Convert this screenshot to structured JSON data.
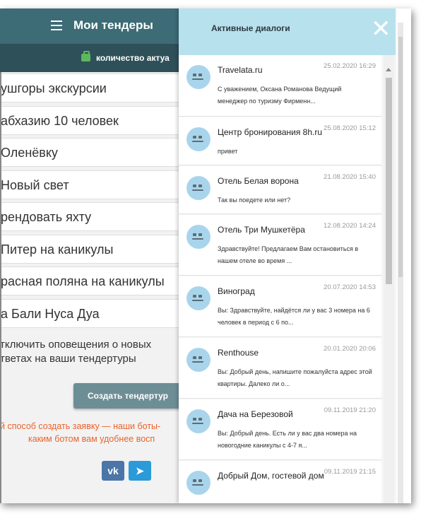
{
  "header": {
    "title": "Мои тендеры"
  },
  "count_bar": {
    "text": "количество актуа"
  },
  "tenders": [
    "ушгоры экскурсии",
    " абхазию 10 человек",
    " Оленёвку",
    " Новый свет",
    "рендовать яхту",
    " Питер на каникулы",
    "расная поляна на каникулы",
    "а Бали Нуса Дуа"
  ],
  "notice": {
    "line1": "тключить оповещения о новых",
    "line2": "тветах на ваши тендертуры"
  },
  "create_button": "Создать тендертур",
  "bots": {
    "line1": "й способ создать заявку — наши боты-",
    "line2": "каким ботом вам удобнее восп"
  },
  "social": {
    "vk": "vk",
    "telegram": "➤"
  },
  "panel": {
    "title": "Активные диалоги",
    "close": "✕"
  },
  "dialogs": [
    {
      "name": "Travelata.ru",
      "date": "25.02.2020 16:29",
      "message": "С уважением, Оксана Романова Ведущий менеджер по туризму Фирменн..."
    },
    {
      "name": "Центр бронирования 8h.ru",
      "date": "25.08.2020 15:12",
      "message": "привет"
    },
    {
      "name": "Отель Белая ворона",
      "date": "21.08.2020 15:40",
      "message": "Так вы поедете или нет?"
    },
    {
      "name": "Отель Три Мушкетёра",
      "date": "12.08.2020 14:24",
      "message": "Здравствуйте! Предлагаем Вам остановиться в нашем отеле во время ..."
    },
    {
      "name": "Виноград",
      "date": "20.07.2020 14:53",
      "message": "Вы: Здравствуйте, найдётся ли у вас 3 номера на 6 человек в период с 6 по..."
    },
    {
      "name": "Renthouse",
      "date": "20.01.2020 20:06",
      "message": "Вы: Добрый день, напишите пожалуйста адрес этой квартиры. Далеко ли о..."
    },
    {
      "name": "Дача на Березовой",
      "date": "09.11.2019 21:20",
      "message": "Вы: Добрый день. Есть ли у вас два номера на новогодние каникулы с 4-7 я..."
    },
    {
      "name": "Добрый Дом, гостевой дом",
      "date": "09.11.2019 21:15",
      "message": ""
    }
  ]
}
